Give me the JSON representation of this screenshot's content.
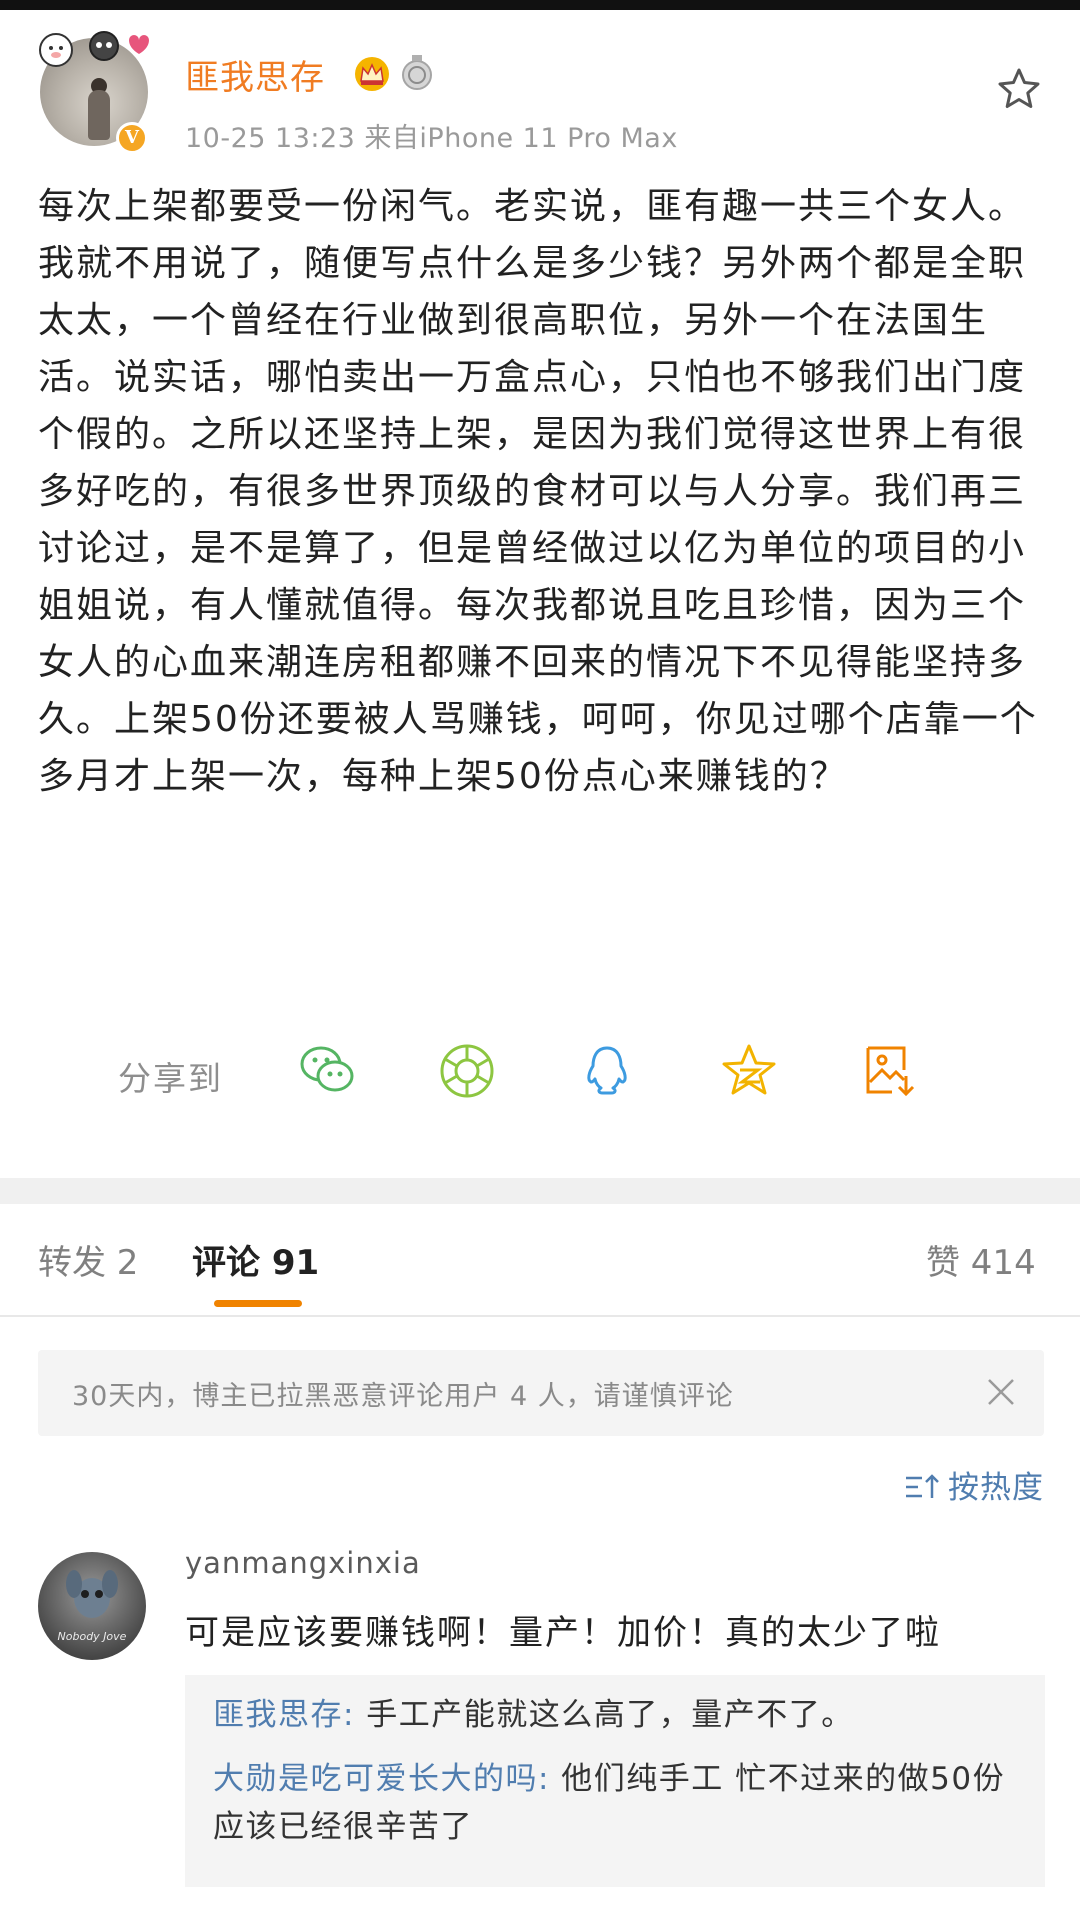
{
  "post": {
    "username": "匪我思存",
    "meta": "10-25 13:23  来自iPhone 11 Pro Max",
    "verified_badge": "V",
    "body": "每次上架都要受一份闲气。老实说，匪有趣一共三个女人。我就不用说了，随便写点什么是多少钱？另外两个都是全职太太，一个曾经在行业做到很高职位，另外一个在法国生活。说实话，哪怕卖出一万盒点心，只怕也不够我们出门度个假的。之所以还坚持上架，是因为我们觉得这世界上有很多好吃的，有很多世界顶级的食材可以与人分享。我们再三讨论过，是不是算了，但是曾经做过以亿为单位的项目的小姐姐说，有人懂就值得。每次我都说且吃且珍惜，因为三个女人的心血来潮连房租都赚不回来的情况下不见得能坚持多久。上架50份还要被人骂赚钱，呵呵，你见过哪个店靠一个多月才上架一次，每种上架50份点心来赚钱的？",
    "icons": [
      "crown-icon",
      "medal-icon",
      "star-outline-icon"
    ]
  },
  "share": {
    "label": "分享到",
    "targets": [
      "wechat-icon",
      "moments-icon",
      "qq-icon",
      "qzone-icon",
      "save-image-icon"
    ]
  },
  "tabs": {
    "repost": "转发 2",
    "comments": "评论 91",
    "likes": "赞 414"
  },
  "notice": {
    "text": "30天内，博主已拉黑恶意评论用户 4 人，请谨慎评论"
  },
  "sort": {
    "label": "按热度"
  },
  "comment": {
    "username": "yanmangxinxia",
    "avatar_caption": "Nobody Jove",
    "text": "可是应该要赚钱啊！量产！加价！真的太少了啦",
    "replies": [
      {
        "who": "匪我思存:",
        "text": " 手工产能就这么高了，量产不了。"
      },
      {
        "who": "大勋是吃可爱长大的吗:",
        "text": " 他们纯手工 忙不过来的做50份应该已经很辛苦了"
      }
    ]
  },
  "colors": {
    "username": "#f07c22",
    "link_blue": "#507daf",
    "tab_underline": "#f08300",
    "verified": "#f5a623"
  }
}
